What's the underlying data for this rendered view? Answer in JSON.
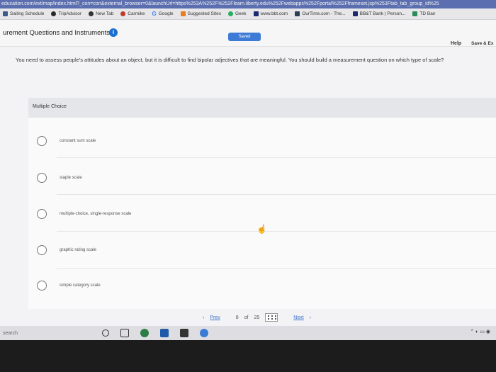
{
  "browser": {
    "url": "education.com/ext/map/index.html?_con=con&external_browser=0&launchUrl=https%253A%252F%252Flearn.liberty.edu%252Fwebapps%252Fportal%252Fframeset.jsp%253Ftab_tab_group_id%25",
    "bookmarks": [
      {
        "label": "Sailing Schedule",
        "color": "#3a5a8c"
      },
      {
        "label": "TripAdvisor",
        "color": "#2a2a2a"
      },
      {
        "label": "New Tab",
        "color": "#333"
      },
      {
        "label": "Carmike",
        "color": "#c0392b"
      },
      {
        "label": "Google",
        "color": "#4285f4"
      },
      {
        "label": "Suggested Sites",
        "color": "#e67e22"
      },
      {
        "label": "Geek",
        "color": "#27ae60"
      },
      {
        "label": "www.bbt.com",
        "color": "#1a2a6c"
      },
      {
        "label": "OurTime.com - The...",
        "color": "#2c3e50"
      },
      {
        "label": "BB&T Bank | Person...",
        "color": "#1a2a6c"
      },
      {
        "label": "TD Ban",
        "color": "#2e8b57"
      }
    ]
  },
  "header": {
    "title": "urement Questions and Instruments",
    "saved_label": "Saved",
    "help_label": "Help",
    "save_exit_label": "Save & Ex"
  },
  "question": {
    "text": "You need to assess people's attitudes about an object, but it is difficult to find bipolar adjectives that are meaningful. You should build a measurement question on which type of scale?",
    "type_label": "Multiple Choice",
    "options": [
      {
        "label": "constant sum scale"
      },
      {
        "label": "staple scale"
      },
      {
        "label": "multiple-choice, single-response scale"
      },
      {
        "label": "graphic rating scale"
      },
      {
        "label": "simple category scale"
      }
    ]
  },
  "pagination": {
    "prev_label": "Prev",
    "current": "8",
    "of_label": "of",
    "total": "25",
    "next_label": "Next"
  },
  "taskbar": {
    "search_placeholder": "search"
  },
  "colors": {
    "accent": "#3d7bd6",
    "info": "#1a6fd1"
  }
}
